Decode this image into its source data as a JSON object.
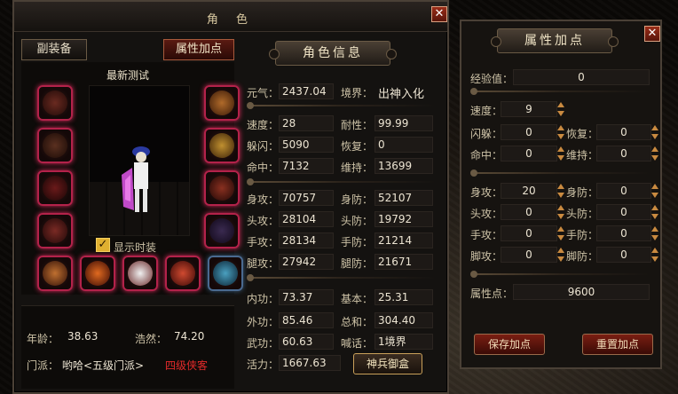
{
  "window": {
    "title": "角  色"
  },
  "tabs": {
    "sub_equip": "副装备",
    "attr_points": "属性加点"
  },
  "character": {
    "name": "最新测试",
    "show_fashion_label": "显示时装"
  },
  "info_bottom": {
    "age_label": "年龄：",
    "age": "38.63",
    "haoran_label": "浩然：",
    "haoran": "74.20",
    "sect_label": "门派：",
    "sect": "哟哈<五级门派>",
    "sect_rank": "四级侠客"
  },
  "char_info": {
    "header": "角色信息",
    "qi_label": "元气：",
    "qi": "2437.04",
    "realm_label": "境界：",
    "realm": "出神入化",
    "speed_label": "速度：",
    "speed": "28",
    "durability_label": "耐性：",
    "durability": "99.99",
    "dodge_label": "躲闪：",
    "dodge": "5090",
    "recover_label": "恢复：",
    "recover": "0",
    "hit_label": "命中：",
    "hit": "7132",
    "maintain_label": "维持：",
    "maintain": "13699",
    "body_atk_label": "身攻：",
    "body_atk": "70757",
    "body_def_label": "身防：",
    "body_def": "52107",
    "head_atk_label": "头攻：",
    "head_atk": "28104",
    "head_def_label": "头防：",
    "head_def": "19792",
    "hand_atk_label": "手攻：",
    "hand_atk": "28134",
    "hand_def_label": "手防：",
    "hand_def": "21214",
    "leg_atk_label": "腿攻：",
    "leg_atk": "27942",
    "leg_def_label": "腿防：",
    "leg_def": "21671",
    "inner_label": "内功：",
    "inner": "73.37",
    "base_label": "基本：",
    "base": "25.31",
    "outer_label": "外功：",
    "outer": "85.46",
    "total_label": "总和：",
    "total": "304.40",
    "martial_label": "武功：",
    "martial": "60.63",
    "shout_label": "喊话：",
    "shout": "1境界",
    "vitality_label": "活力：",
    "vitality": "1667.63",
    "weapon_box_button": "神兵御盒"
  },
  "attr_panel": {
    "header": "属性加点",
    "exp_label": "经验值：",
    "exp": "0",
    "speed_label": "速度：",
    "speed": "9",
    "dodge_label": "闪躲：",
    "dodge": "0",
    "recover_label": "恢复：",
    "recover": "0",
    "hit_label": "命中：",
    "hit": "0",
    "maintain_label": "维持：",
    "maintain": "0",
    "body_atk_label": "身攻：",
    "body_atk": "20",
    "body_def_label": "身防：",
    "body_def": "0",
    "head_atk_label": "头攻：",
    "head_atk": "0",
    "head_def_label": "头防：",
    "head_def": "0",
    "hand_atk_label": "手攻：",
    "hand_atk": "0",
    "hand_def_label": "手防：",
    "hand_def": "0",
    "leg_atk_label": "脚攻：",
    "leg_atk": "0",
    "leg_def_label": "脚防：",
    "leg_def": "0",
    "points_label": "属性点：",
    "points": "9600",
    "save_button": "保存加点",
    "reset_button": "重置加点"
  },
  "colors": {
    "slot_glow": "#d62a5a",
    "rank_red": "#e22a2a",
    "panel_bg": "#141210"
  },
  "icons": {
    "close": "close-icon",
    "check": "check-icon"
  }
}
